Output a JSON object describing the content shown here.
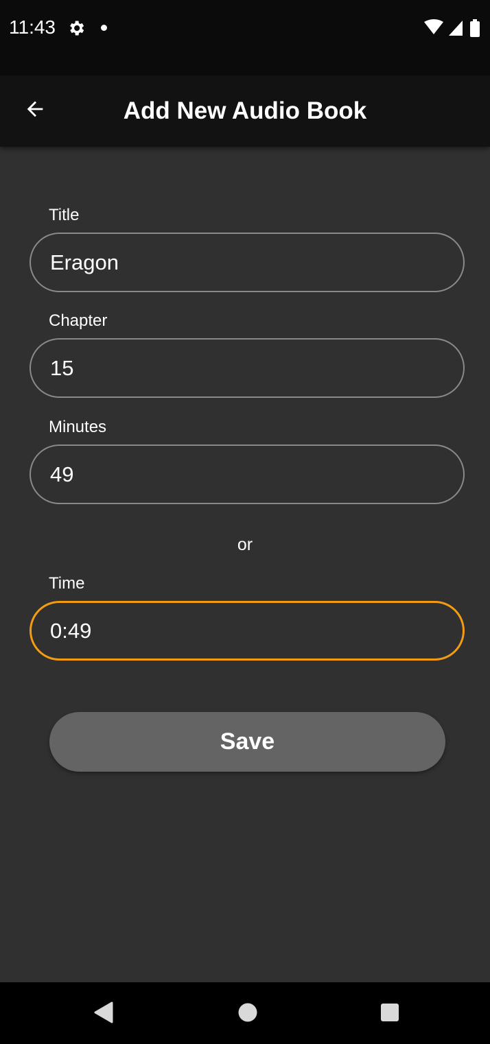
{
  "status_bar": {
    "time": "11:43",
    "icons": [
      "gear-icon",
      "notification-dot-icon",
      "wifi-icon",
      "signal-icon",
      "battery-icon"
    ]
  },
  "app_bar": {
    "back_icon": "arrow-left-icon",
    "title": "Add New Audio Book"
  },
  "form": {
    "title": {
      "label": "Title",
      "value": "Eragon"
    },
    "chapter": {
      "label": "Chapter",
      "value": "15"
    },
    "minutes": {
      "label": "Minutes",
      "value": "49"
    },
    "separator": "or",
    "time": {
      "label": "Time",
      "value": "0:49",
      "focused": true
    },
    "save_label": "Save"
  },
  "nav_bar": {
    "icons": [
      "back-triangle-icon",
      "home-circle-icon",
      "recents-square-icon"
    ]
  },
  "colors": {
    "background": "#303030",
    "app_bar": "#121212",
    "focus_accent": "#f39c12",
    "button": "#646464"
  }
}
